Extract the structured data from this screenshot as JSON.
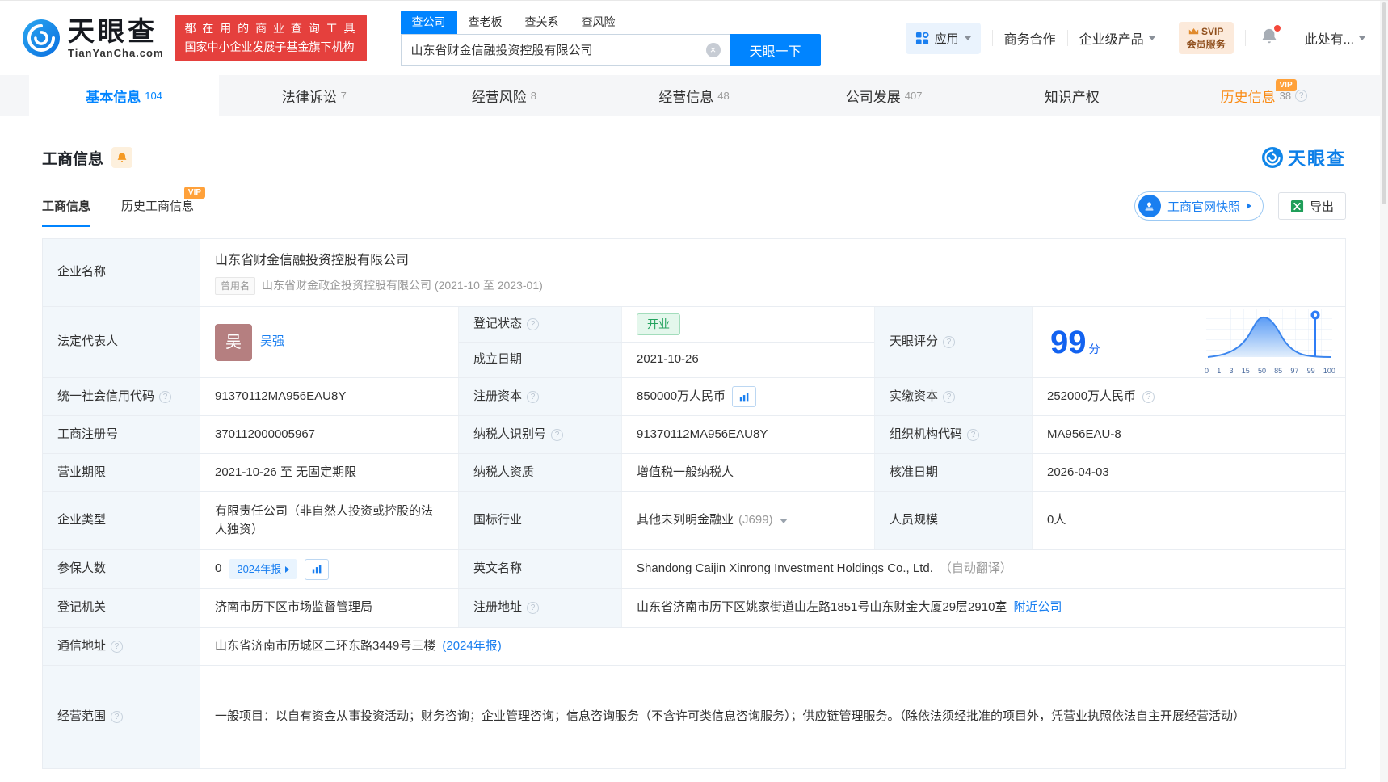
{
  "header": {
    "logo": {
      "brand": "天眼查",
      "domain": "TianYanCha.com"
    },
    "slogan": {
      "line1": "都 在 用 的 商 业 查 询 工 具",
      "line2": "国家中小企业发展子基金旗下机构"
    },
    "search": {
      "tabs": [
        {
          "label": "查公司"
        },
        {
          "label": "查老板"
        },
        {
          "label": "查关系"
        },
        {
          "label": "查风险"
        }
      ],
      "value": "山东省财金信融投资控股有限公司",
      "button": "天眼一下"
    },
    "nav": {
      "apps": "应用",
      "cooperation": "商务合作",
      "enterprise": "企业级产品",
      "svip_line1": "SVIP",
      "svip_line2": "会员服务",
      "more": "此处有..."
    }
  },
  "tabs": [
    {
      "label": "基本信息",
      "count": "104"
    },
    {
      "label": "法律诉讼",
      "count": "7"
    },
    {
      "label": "经营风险",
      "count": "8"
    },
    {
      "label": "经营信息",
      "count": "48"
    },
    {
      "label": "公司发展",
      "count": "407"
    },
    {
      "label": "知识产权",
      "count": ""
    },
    {
      "label": "历史信息",
      "count": "38",
      "vip": "VIP"
    }
  ],
  "section": {
    "title": "工商信息",
    "watermark": "天眼查",
    "subtabs": [
      {
        "label": "工商信息"
      },
      {
        "label": "历史工商信息",
        "vip": "VIP"
      }
    ],
    "snapshot_button": "工商官网快照",
    "export_button": "导出"
  },
  "table": {
    "company_name": {
      "label": "企业名称",
      "value": "山东省财金信融投资控股有限公司"
    },
    "former_name": {
      "badge": "曾用名",
      "value": "山东省财金政企投资控股有限公司 (2021-10 至 2023-01)"
    },
    "legal_rep": {
      "label": "法定代表人",
      "avatar": "吴",
      "name": "吴强"
    },
    "reg_status": {
      "label": "登记状态",
      "value": "开业"
    },
    "establish_date": {
      "label": "成立日期",
      "value": "2021-10-26"
    },
    "score": {
      "label": "天眼评分",
      "value": "99",
      "unit": "分"
    },
    "credit_code": {
      "label": "统一社会信用代码",
      "value": "91370112MA956EAU8Y"
    },
    "reg_capital": {
      "label": "注册资本",
      "value": "850000万人民币"
    },
    "paid_capital": {
      "label": "实缴资本",
      "value": "252000万人民币"
    },
    "reg_number": {
      "label": "工商注册号",
      "value": "370112000005967"
    },
    "taxpayer_id": {
      "label": "纳税人识别号",
      "value": "91370112MA956EAU8Y"
    },
    "org_code": {
      "label": "组织机构代码",
      "value": "MA956EAU-8"
    },
    "business_term": {
      "label": "营业期限",
      "value": "2021-10-26 至 无固定期限"
    },
    "taxpayer_quality": {
      "label": "纳税人资质",
      "value": "增值税一般纳税人"
    },
    "approval_date": {
      "label": "核准日期",
      "value": "2026-04-03"
    },
    "company_type": {
      "label": "企业类型",
      "value": "有限责任公司（非自然人投资或控股的法人独资）"
    },
    "industry": {
      "label": "国标行业",
      "value": "其他未列明金融业",
      "code": "(J699)"
    },
    "staff_size": {
      "label": "人员规模",
      "value": "0人"
    },
    "insured": {
      "label": "参保人数",
      "value": "0",
      "report": "2024年报"
    },
    "english_name": {
      "label": "英文名称",
      "value": "Shandong Caijin Xinrong Investment Holdings Co., Ltd.",
      "note": "（自动翻译）"
    },
    "reg_authority": {
      "label": "登记机关",
      "value": "济南市历下区市场监督管理局"
    },
    "reg_address": {
      "label": "注册地址",
      "value": "山东省济南市历下区姚家街道山左路1851号山东财金大厦29层2910室",
      "link": "附近公司"
    },
    "mail_address": {
      "label": "通信地址",
      "value": "山东省济南市历城区二环东路3449号三楼",
      "link": "(2024年报)"
    },
    "business_scope": {
      "label": "经营范围",
      "value": "一般项目：以自有资金从事投资活动；财务咨询；企业管理咨询；信息咨询服务（不含许可类信息咨询服务）；供应链管理服务。（除依法须经批准的项目外，凭营业执照依法自主开展经营活动）"
    }
  },
  "score_chart": {
    "type": "area",
    "x_ticks": [
      "0",
      "1",
      "3",
      "15",
      "50",
      "85",
      "97",
      "99",
      "100"
    ],
    "marker_value": 99,
    "description": "天眼评分分布曲线，当前企业评分99，位于99分位附近"
  },
  "colors": {
    "brand_blue": "#0084ff",
    "promo_red": "#e5403d",
    "vip_orange": "#ffa13a",
    "history_tab_orange": "#fa8c16",
    "status_green": "#23a35e",
    "score_blue": "#1262f0",
    "label_cell_bg": "#f2f7fb"
  }
}
